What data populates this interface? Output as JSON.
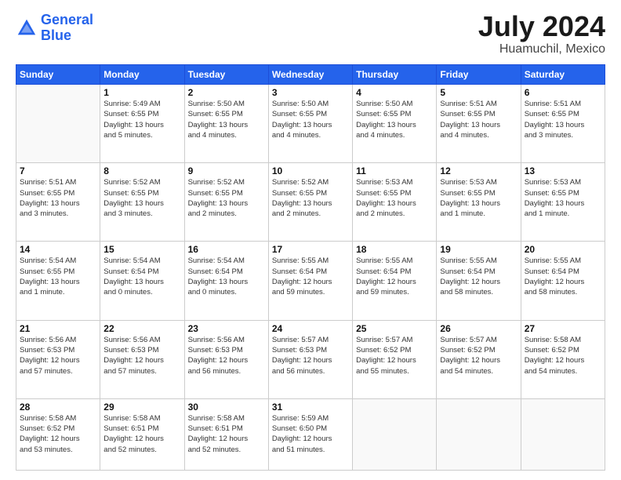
{
  "header": {
    "logo_line1": "General",
    "logo_line2": "Blue",
    "month": "July 2024",
    "location": "Huamuchil, Mexico"
  },
  "days_of_week": [
    "Sunday",
    "Monday",
    "Tuesday",
    "Wednesday",
    "Thursday",
    "Friday",
    "Saturday"
  ],
  "weeks": [
    [
      {
        "day": "",
        "info": ""
      },
      {
        "day": "1",
        "info": "Sunrise: 5:49 AM\nSunset: 6:55 PM\nDaylight: 13 hours\nand 5 minutes."
      },
      {
        "day": "2",
        "info": "Sunrise: 5:50 AM\nSunset: 6:55 PM\nDaylight: 13 hours\nand 4 minutes."
      },
      {
        "day": "3",
        "info": "Sunrise: 5:50 AM\nSunset: 6:55 PM\nDaylight: 13 hours\nand 4 minutes."
      },
      {
        "day": "4",
        "info": "Sunrise: 5:50 AM\nSunset: 6:55 PM\nDaylight: 13 hours\nand 4 minutes."
      },
      {
        "day": "5",
        "info": "Sunrise: 5:51 AM\nSunset: 6:55 PM\nDaylight: 13 hours\nand 4 minutes."
      },
      {
        "day": "6",
        "info": "Sunrise: 5:51 AM\nSunset: 6:55 PM\nDaylight: 13 hours\nand 3 minutes."
      }
    ],
    [
      {
        "day": "7",
        "info": "Sunrise: 5:51 AM\nSunset: 6:55 PM\nDaylight: 13 hours\nand 3 minutes."
      },
      {
        "day": "8",
        "info": "Sunrise: 5:52 AM\nSunset: 6:55 PM\nDaylight: 13 hours\nand 3 minutes."
      },
      {
        "day": "9",
        "info": "Sunrise: 5:52 AM\nSunset: 6:55 PM\nDaylight: 13 hours\nand 2 minutes."
      },
      {
        "day": "10",
        "info": "Sunrise: 5:52 AM\nSunset: 6:55 PM\nDaylight: 13 hours\nand 2 minutes."
      },
      {
        "day": "11",
        "info": "Sunrise: 5:53 AM\nSunset: 6:55 PM\nDaylight: 13 hours\nand 2 minutes."
      },
      {
        "day": "12",
        "info": "Sunrise: 5:53 AM\nSunset: 6:55 PM\nDaylight: 13 hours\nand 1 minute."
      },
      {
        "day": "13",
        "info": "Sunrise: 5:53 AM\nSunset: 6:55 PM\nDaylight: 13 hours\nand 1 minute."
      }
    ],
    [
      {
        "day": "14",
        "info": "Sunrise: 5:54 AM\nSunset: 6:55 PM\nDaylight: 13 hours\nand 1 minute."
      },
      {
        "day": "15",
        "info": "Sunrise: 5:54 AM\nSunset: 6:54 PM\nDaylight: 13 hours\nand 0 minutes."
      },
      {
        "day": "16",
        "info": "Sunrise: 5:54 AM\nSunset: 6:54 PM\nDaylight: 13 hours\nand 0 minutes."
      },
      {
        "day": "17",
        "info": "Sunrise: 5:55 AM\nSunset: 6:54 PM\nDaylight: 12 hours\nand 59 minutes."
      },
      {
        "day": "18",
        "info": "Sunrise: 5:55 AM\nSunset: 6:54 PM\nDaylight: 12 hours\nand 59 minutes."
      },
      {
        "day": "19",
        "info": "Sunrise: 5:55 AM\nSunset: 6:54 PM\nDaylight: 12 hours\nand 58 minutes."
      },
      {
        "day": "20",
        "info": "Sunrise: 5:55 AM\nSunset: 6:54 PM\nDaylight: 12 hours\nand 58 minutes."
      }
    ],
    [
      {
        "day": "21",
        "info": "Sunrise: 5:56 AM\nSunset: 6:53 PM\nDaylight: 12 hours\nand 57 minutes."
      },
      {
        "day": "22",
        "info": "Sunrise: 5:56 AM\nSunset: 6:53 PM\nDaylight: 12 hours\nand 57 minutes."
      },
      {
        "day": "23",
        "info": "Sunrise: 5:56 AM\nSunset: 6:53 PM\nDaylight: 12 hours\nand 56 minutes."
      },
      {
        "day": "24",
        "info": "Sunrise: 5:57 AM\nSunset: 6:53 PM\nDaylight: 12 hours\nand 56 minutes."
      },
      {
        "day": "25",
        "info": "Sunrise: 5:57 AM\nSunset: 6:52 PM\nDaylight: 12 hours\nand 55 minutes."
      },
      {
        "day": "26",
        "info": "Sunrise: 5:57 AM\nSunset: 6:52 PM\nDaylight: 12 hours\nand 54 minutes."
      },
      {
        "day": "27",
        "info": "Sunrise: 5:58 AM\nSunset: 6:52 PM\nDaylight: 12 hours\nand 54 minutes."
      }
    ],
    [
      {
        "day": "28",
        "info": "Sunrise: 5:58 AM\nSunset: 6:52 PM\nDaylight: 12 hours\nand 53 minutes."
      },
      {
        "day": "29",
        "info": "Sunrise: 5:58 AM\nSunset: 6:51 PM\nDaylight: 12 hours\nand 52 minutes."
      },
      {
        "day": "30",
        "info": "Sunrise: 5:58 AM\nSunset: 6:51 PM\nDaylight: 12 hours\nand 52 minutes."
      },
      {
        "day": "31",
        "info": "Sunrise: 5:59 AM\nSunset: 6:50 PM\nDaylight: 12 hours\nand 51 minutes."
      },
      {
        "day": "",
        "info": ""
      },
      {
        "day": "",
        "info": ""
      },
      {
        "day": "",
        "info": ""
      }
    ]
  ]
}
